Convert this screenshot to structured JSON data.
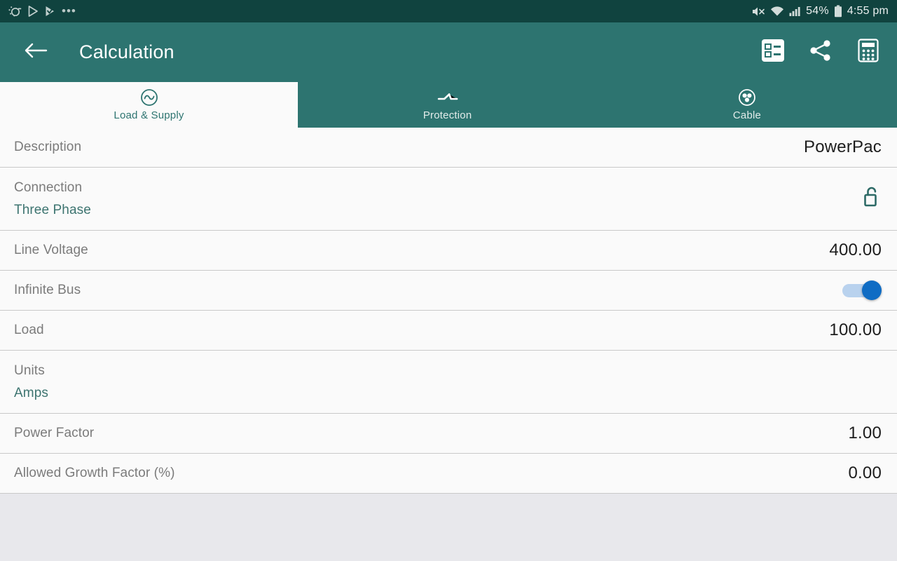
{
  "statusbar": {
    "left_icons": [
      "cast-screen-icon",
      "play-store-icon",
      "play-check-icon",
      "overflow-dots-icon"
    ],
    "overflow_dots": "•••",
    "mute_icon": "volume-mute-icon",
    "wifi_icon": "wifi-icon",
    "signal_icon": "cellular-signal-icon",
    "battery_percent": "54%",
    "battery_icon": "battery-icon",
    "time": "4:55 pm"
  },
  "appbar": {
    "back_icon": "back-arrow-icon",
    "title": "Calculation",
    "actions": [
      {
        "name": "list-view-icon",
        "title": "List view"
      },
      {
        "name": "share-icon",
        "title": "Share"
      },
      {
        "name": "calculator-icon",
        "title": "Calculator"
      }
    ]
  },
  "tabs": [
    {
      "label": "Load & Supply",
      "icon": "ac-sine-wave-icon",
      "active": true
    },
    {
      "label": "Protection",
      "icon": "circuit-breaker-icon",
      "active": false
    },
    {
      "label": "Cable",
      "icon": "three-core-cable-icon",
      "active": false
    }
  ],
  "rows": [
    {
      "label": "Description",
      "value": "PowerPac",
      "type": "value"
    },
    {
      "label": "Connection",
      "subvalue": "Three Phase",
      "type": "subvalue-lock",
      "icon": "unlocked-padlock-icon"
    },
    {
      "label": "Line Voltage",
      "value": "400.00",
      "type": "value"
    },
    {
      "label": "Infinite Bus",
      "type": "toggle",
      "toggle_on": true
    },
    {
      "label": "Load",
      "value": "100.00",
      "type": "value"
    },
    {
      "label": "Units",
      "subvalue": "Amps",
      "type": "subvalue"
    },
    {
      "label": "Power Factor",
      "value": "1.00",
      "type": "value"
    },
    {
      "label": "Allowed Growth Factor (%)",
      "value": "0.00",
      "type": "value"
    }
  ],
  "colors": {
    "statusbar_bg": "#10433f",
    "appbar_bg": "#2d7470",
    "accent_teal": "#2d7470",
    "list_bg": "#fafafa",
    "divider": "#c9c9c9",
    "toggle_on": "#0f6cc4",
    "toggle_track": "#b9d2ee",
    "page_bg": "#e8e8ec"
  }
}
